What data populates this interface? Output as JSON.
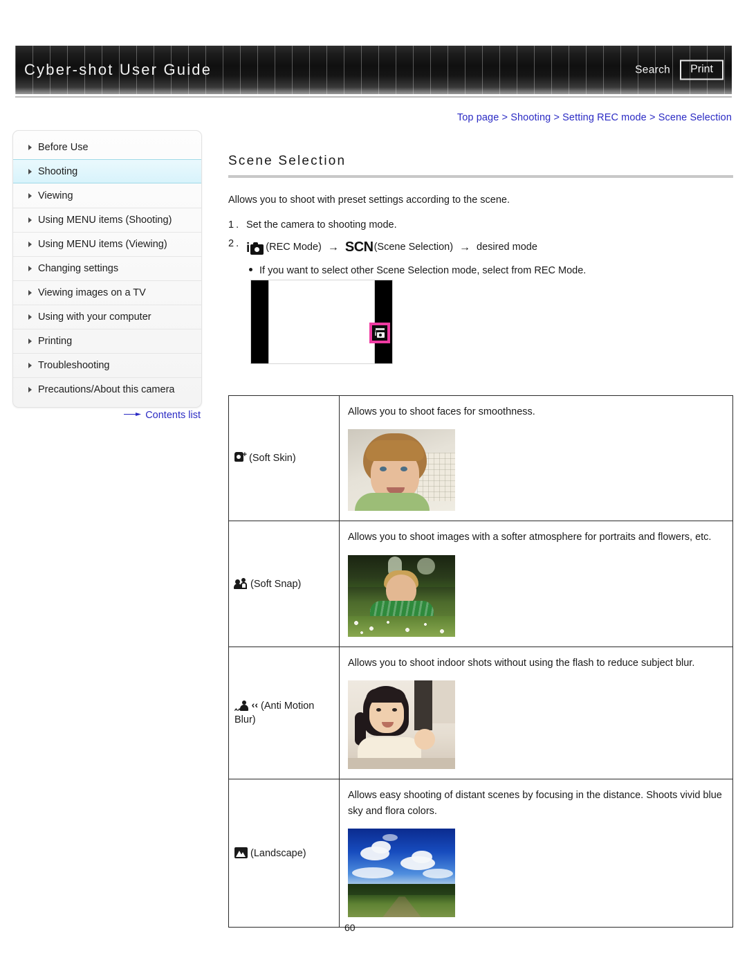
{
  "header": {
    "title": "Cyber-shot User Guide",
    "search_label": "Search",
    "print_label": "Print"
  },
  "breadcrumb": {
    "separator": ">",
    "items": [
      {
        "label": "Top page"
      },
      {
        "label": "Shooting"
      },
      {
        "label": "Setting REC mode"
      },
      {
        "label": "Scene Selection"
      }
    ]
  },
  "sidebar": {
    "items": [
      {
        "label": "Before Use",
        "active": false
      },
      {
        "label": "Shooting",
        "active": true
      },
      {
        "label": "Viewing",
        "active": false
      },
      {
        "label": "Using MENU items (Shooting)",
        "active": false
      },
      {
        "label": "Using MENU items (Viewing)",
        "active": false
      },
      {
        "label": "Changing settings",
        "active": false
      },
      {
        "label": "Viewing images on a TV",
        "active": false
      },
      {
        "label": "Using with your computer",
        "active": false
      },
      {
        "label": "Printing",
        "active": false
      },
      {
        "label": "Troubleshooting",
        "active": false
      },
      {
        "label": "Precautions/About this camera",
        "active": false
      }
    ],
    "contents_link": "Contents list"
  },
  "main": {
    "page_title": "Scene Selection",
    "intro": "Allows you to shoot with preset settings according to the scene.",
    "steps": [
      {
        "num": "1.",
        "text": "Set the camera to shooting mode."
      }
    ],
    "step2": {
      "num": "2.",
      "rec_mode_label": "(REC Mode)",
      "arrow": "→",
      "scn_glyph": "SCN",
      "scene_selection_label": "(Scene Selection)",
      "desired_mode_label": "desired mode",
      "note": "If you want to select other Scene Selection mode, select from REC Mode."
    },
    "illustration": {
      "badge_icon": "rec-mode-icon",
      "highlight_color": "#ef3ba2"
    }
  },
  "table": {
    "rows": [
      {
        "icon": "soft-skin-icon",
        "mode": "(Soft Skin)",
        "description": "Allows you to shoot faces for smoothness.",
        "photo": "boy-portrait-photo"
      },
      {
        "icon": "soft-snap-icon",
        "mode": "(Soft Snap)",
        "description": "Allows you to shoot images with a softer atmosphere for portraits and flowers, etc.",
        "photo": "boy-in-grass-photo"
      },
      {
        "icon": "anti-motion-blur-icon",
        "mode": "(Anti Motion Blur)",
        "description": "Allows you to shoot indoor shots without using the flash to reduce subject blur.",
        "photo": "girl-indoor-photo"
      },
      {
        "icon": "landscape-icon",
        "mode": "(Landscape)",
        "description": "Allows easy shooting of distant scenes by focusing in the distance. Shoots vivid blue sky and flora colors.",
        "photo": "landscape-field-photo"
      }
    ]
  },
  "footer": {
    "page_number": "60"
  }
}
